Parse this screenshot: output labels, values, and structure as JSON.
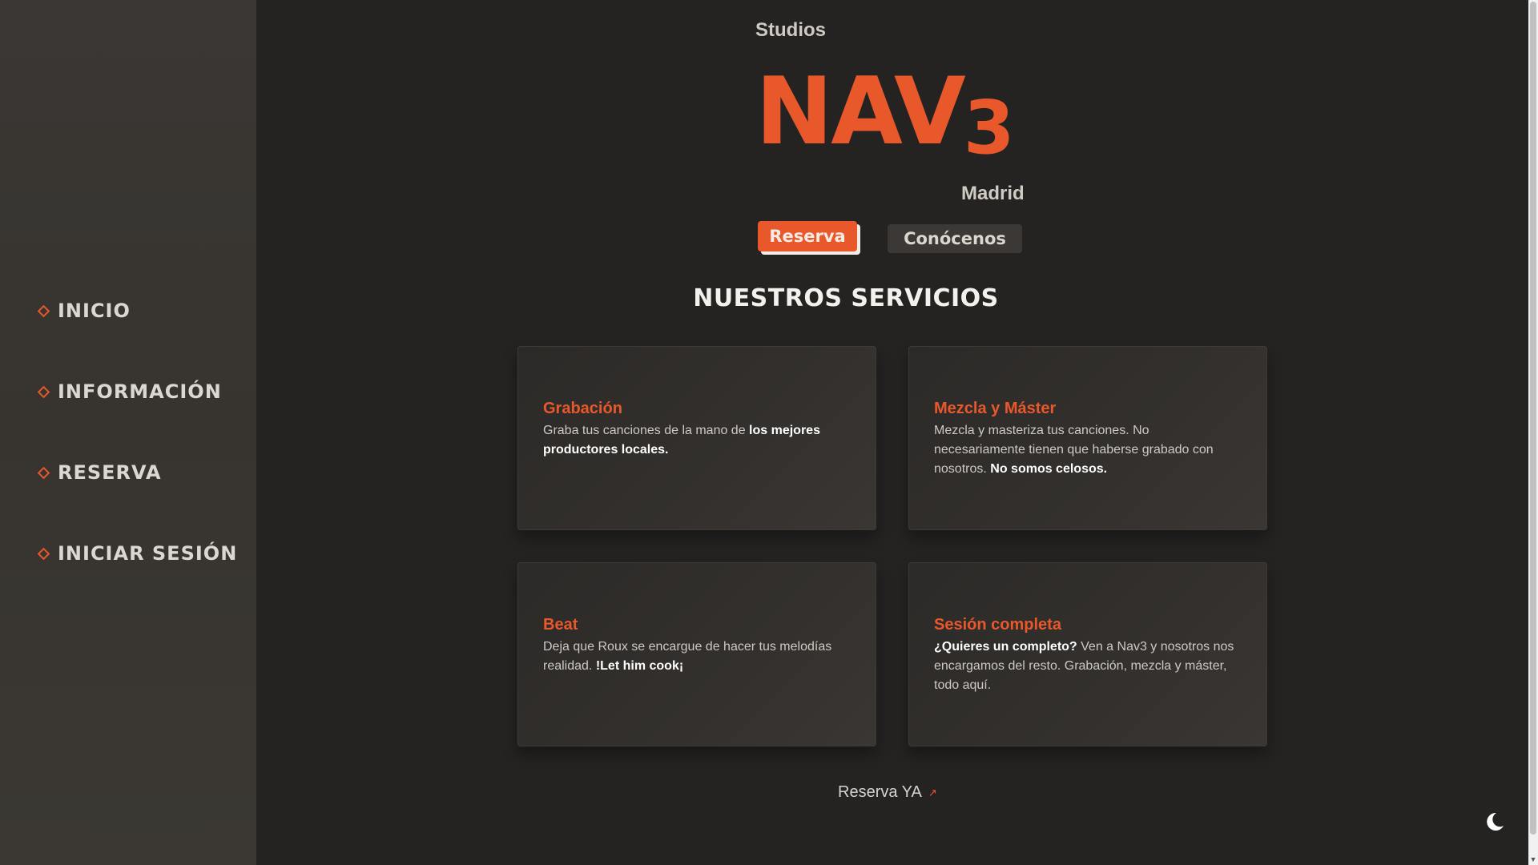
{
  "sidebar": {
    "items": [
      {
        "label": "INICIO",
        "icon": "diamond-icon"
      },
      {
        "label": "INFORMACIÓN",
        "icon": "diamond-icon"
      },
      {
        "label": "RESERVA",
        "icon": "diamond-icon"
      },
      {
        "label": "INICIAR SESIÓN",
        "icon": "diamond-icon"
      }
    ]
  },
  "hero": {
    "studios": "Studios",
    "logo_main": "NAV",
    "logo_number": "3",
    "city": "Madrid",
    "reserve_button": "Reserva",
    "about_button": "Conócenos"
  },
  "services": {
    "title": "NUESTROS SERVICIOS",
    "cards": [
      {
        "title": "Grabación",
        "text_plain": "Graba tus canciones de la mano de ",
        "text_bold": "los mejores productores locales."
      },
      {
        "title": "Mezcla y Máster",
        "text_plain": "Mezcla y masteriza tus canciones. No necesariamente tienen que haberse grabado con nosotros. ",
        "text_bold": "No somos celosos."
      },
      {
        "title": "Beat",
        "text_plain": "Deja que Roux se encargue de hacer tus melodías realidad. ",
        "text_bold": "!Let him cook¡"
      },
      {
        "title": "Sesión completa",
        "text_bold": "¿Quieres un completo?",
        "text_plain": " Ven a Nav3 y nosotros nos encargamos del resto. Grabación, mezcla y máster, todo aquí."
      }
    ]
  },
  "cta": {
    "label": "Reserva YA",
    "arrow": "↗"
  },
  "theme_toggle": {
    "icon": "moon-icon"
  },
  "colors": {
    "accent": "#e8582a",
    "background": "#242322",
    "sidebar": "#38352f"
  }
}
